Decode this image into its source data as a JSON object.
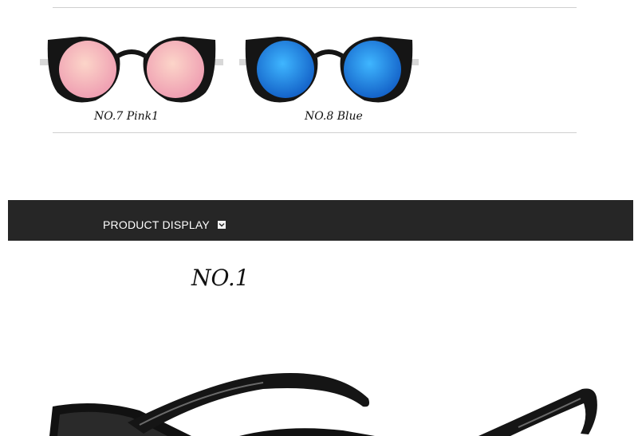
{
  "variants": [
    {
      "label": "NO.7 Pink1",
      "lens_color": "#f0a5b0",
      "lens_highlight": "#fbd0c8"
    },
    {
      "label": "NO.8 Blue",
      "lens_color": "#1e7fe0",
      "lens_highlight": "#3fb2ff"
    }
  ],
  "banner": {
    "label": "PRODUCT DISPLAY",
    "icon": "chevron-down-icon"
  },
  "product": {
    "number": "NO.1"
  },
  "colors": {
    "banner_bg": "#262626",
    "frame": "#151515"
  }
}
